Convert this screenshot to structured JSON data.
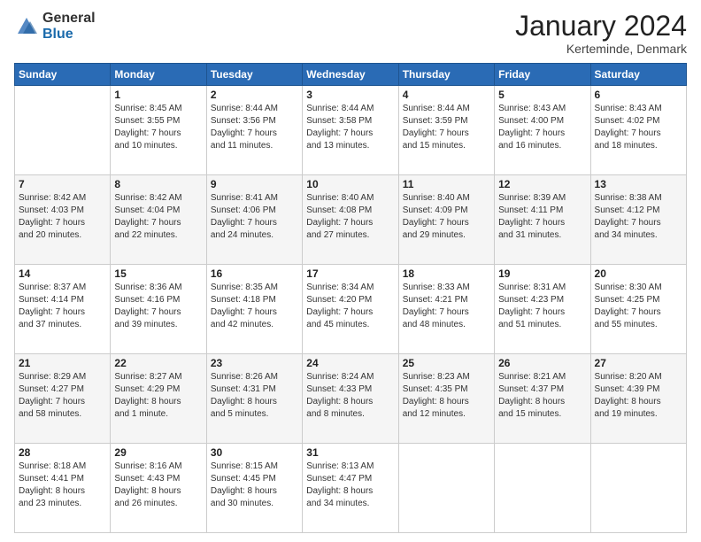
{
  "logo": {
    "general": "General",
    "blue": "Blue"
  },
  "title": "January 2024",
  "location": "Kerteminde, Denmark",
  "days_of_week": [
    "Sunday",
    "Monday",
    "Tuesday",
    "Wednesday",
    "Thursday",
    "Friday",
    "Saturday"
  ],
  "weeks": [
    [
      {
        "day": "",
        "content": ""
      },
      {
        "day": "1",
        "content": "Sunrise: 8:45 AM\nSunset: 3:55 PM\nDaylight: 7 hours\nand 10 minutes."
      },
      {
        "day": "2",
        "content": "Sunrise: 8:44 AM\nSunset: 3:56 PM\nDaylight: 7 hours\nand 11 minutes."
      },
      {
        "day": "3",
        "content": "Sunrise: 8:44 AM\nSunset: 3:58 PM\nDaylight: 7 hours\nand 13 minutes."
      },
      {
        "day": "4",
        "content": "Sunrise: 8:44 AM\nSunset: 3:59 PM\nDaylight: 7 hours\nand 15 minutes."
      },
      {
        "day": "5",
        "content": "Sunrise: 8:43 AM\nSunset: 4:00 PM\nDaylight: 7 hours\nand 16 minutes."
      },
      {
        "day": "6",
        "content": "Sunrise: 8:43 AM\nSunset: 4:02 PM\nDaylight: 7 hours\nand 18 minutes."
      }
    ],
    [
      {
        "day": "7",
        "content": "Sunrise: 8:42 AM\nSunset: 4:03 PM\nDaylight: 7 hours\nand 20 minutes."
      },
      {
        "day": "8",
        "content": "Sunrise: 8:42 AM\nSunset: 4:04 PM\nDaylight: 7 hours\nand 22 minutes."
      },
      {
        "day": "9",
        "content": "Sunrise: 8:41 AM\nSunset: 4:06 PM\nDaylight: 7 hours\nand 24 minutes."
      },
      {
        "day": "10",
        "content": "Sunrise: 8:40 AM\nSunset: 4:08 PM\nDaylight: 7 hours\nand 27 minutes."
      },
      {
        "day": "11",
        "content": "Sunrise: 8:40 AM\nSunset: 4:09 PM\nDaylight: 7 hours\nand 29 minutes."
      },
      {
        "day": "12",
        "content": "Sunrise: 8:39 AM\nSunset: 4:11 PM\nDaylight: 7 hours\nand 31 minutes."
      },
      {
        "day": "13",
        "content": "Sunrise: 8:38 AM\nSunset: 4:12 PM\nDaylight: 7 hours\nand 34 minutes."
      }
    ],
    [
      {
        "day": "14",
        "content": "Sunrise: 8:37 AM\nSunset: 4:14 PM\nDaylight: 7 hours\nand 37 minutes."
      },
      {
        "day": "15",
        "content": "Sunrise: 8:36 AM\nSunset: 4:16 PM\nDaylight: 7 hours\nand 39 minutes."
      },
      {
        "day": "16",
        "content": "Sunrise: 8:35 AM\nSunset: 4:18 PM\nDaylight: 7 hours\nand 42 minutes."
      },
      {
        "day": "17",
        "content": "Sunrise: 8:34 AM\nSunset: 4:20 PM\nDaylight: 7 hours\nand 45 minutes."
      },
      {
        "day": "18",
        "content": "Sunrise: 8:33 AM\nSunset: 4:21 PM\nDaylight: 7 hours\nand 48 minutes."
      },
      {
        "day": "19",
        "content": "Sunrise: 8:31 AM\nSunset: 4:23 PM\nDaylight: 7 hours\nand 51 minutes."
      },
      {
        "day": "20",
        "content": "Sunrise: 8:30 AM\nSunset: 4:25 PM\nDaylight: 7 hours\nand 55 minutes."
      }
    ],
    [
      {
        "day": "21",
        "content": "Sunrise: 8:29 AM\nSunset: 4:27 PM\nDaylight: 7 hours\nand 58 minutes."
      },
      {
        "day": "22",
        "content": "Sunrise: 8:27 AM\nSunset: 4:29 PM\nDaylight: 8 hours\nand 1 minute."
      },
      {
        "day": "23",
        "content": "Sunrise: 8:26 AM\nSunset: 4:31 PM\nDaylight: 8 hours\nand 5 minutes."
      },
      {
        "day": "24",
        "content": "Sunrise: 8:24 AM\nSunset: 4:33 PM\nDaylight: 8 hours\nand 8 minutes."
      },
      {
        "day": "25",
        "content": "Sunrise: 8:23 AM\nSunset: 4:35 PM\nDaylight: 8 hours\nand 12 minutes."
      },
      {
        "day": "26",
        "content": "Sunrise: 8:21 AM\nSunset: 4:37 PM\nDaylight: 8 hours\nand 15 minutes."
      },
      {
        "day": "27",
        "content": "Sunrise: 8:20 AM\nSunset: 4:39 PM\nDaylight: 8 hours\nand 19 minutes."
      }
    ],
    [
      {
        "day": "28",
        "content": "Sunrise: 8:18 AM\nSunset: 4:41 PM\nDaylight: 8 hours\nand 23 minutes."
      },
      {
        "day": "29",
        "content": "Sunrise: 8:16 AM\nSunset: 4:43 PM\nDaylight: 8 hours\nand 26 minutes."
      },
      {
        "day": "30",
        "content": "Sunrise: 8:15 AM\nSunset: 4:45 PM\nDaylight: 8 hours\nand 30 minutes."
      },
      {
        "day": "31",
        "content": "Sunrise: 8:13 AM\nSunset: 4:47 PM\nDaylight: 8 hours\nand 34 minutes."
      },
      {
        "day": "",
        "content": ""
      },
      {
        "day": "",
        "content": ""
      },
      {
        "day": "",
        "content": ""
      }
    ]
  ]
}
